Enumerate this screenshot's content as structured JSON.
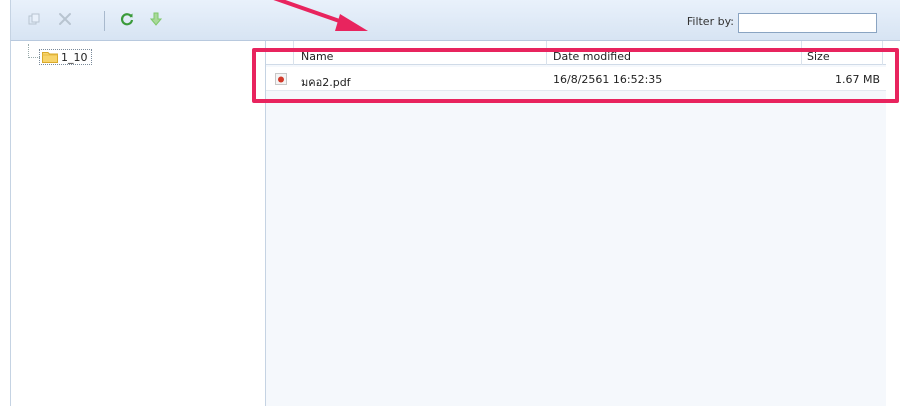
{
  "toolbar": {
    "filter_label": "Filter by:",
    "filter_value": "",
    "colors": {
      "refresh": "#3a9a3a",
      "download": "#7ec86a",
      "disabled": "#b8c4d0"
    }
  },
  "tree": {
    "nodes": [
      {
        "label": "1_10"
      }
    ]
  },
  "list": {
    "columns": {
      "name": "Name",
      "date": "Date modified",
      "size": "Size"
    },
    "rows": [
      {
        "name": "มคอ2.pdf",
        "date": "16/8/2561 16:52:35",
        "size": "1.67 MB",
        "icon": "pdf-file-icon"
      }
    ]
  },
  "annotation": {
    "color": "#e8245e"
  }
}
